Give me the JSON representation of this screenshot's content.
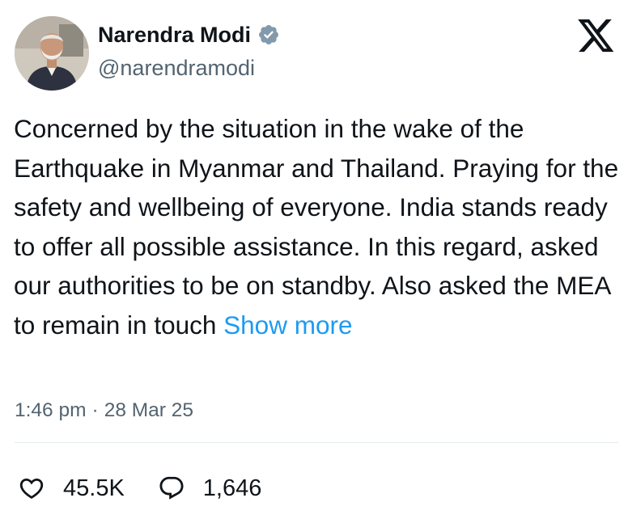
{
  "author": {
    "display_name": "Narendra Modi",
    "handle": "@narendramodi",
    "verified": true,
    "avatar_icon": "profile-photo"
  },
  "platform": {
    "logo": "x-logo-icon"
  },
  "tweet": {
    "text": "Concerned by the situation in the wake of the Earthquake in Myanmar and Thailand. Praying for the safety and wellbeing of everyone. India stands ready to offer all possible assistance. In this regard, asked our authorities to be on standby. Also asked the MEA to remain in touch",
    "show_more_label": "Show more"
  },
  "meta": {
    "time": "1:46 pm",
    "separator": "·",
    "date": "28 Mar 25"
  },
  "actions": {
    "likes": "45.5K",
    "replies": "1,646"
  },
  "colors": {
    "accent": "#1d9bf0",
    "text": "#0f1419",
    "secondary": "#536471",
    "verified_badge": "#829aab"
  }
}
